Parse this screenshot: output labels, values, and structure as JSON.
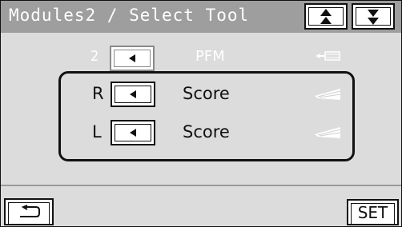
{
  "header": {
    "title": "Modules2 / Select Tool",
    "up_icon": "double-up-arrow",
    "down_icon": "double-down-arrow"
  },
  "top_row": {
    "number": "2",
    "button_icon": "left-triangle",
    "name": "PFM",
    "tool_icon": "tool-holder-small"
  },
  "panel": {
    "rows": [
      {
        "side": "R",
        "button_icon": "left-triangle",
        "name": "Score",
        "tool_icon": "score-blade"
      },
      {
        "side": "L",
        "button_icon": "left-triangle",
        "name": "Score",
        "tool_icon": "score-blade"
      }
    ]
  },
  "footer": {
    "back_icon": "return-arrow",
    "set_label": "SET"
  },
  "colors": {
    "header_bg": "#9e9e9e",
    "screen_bg": "#dcdcdc"
  }
}
